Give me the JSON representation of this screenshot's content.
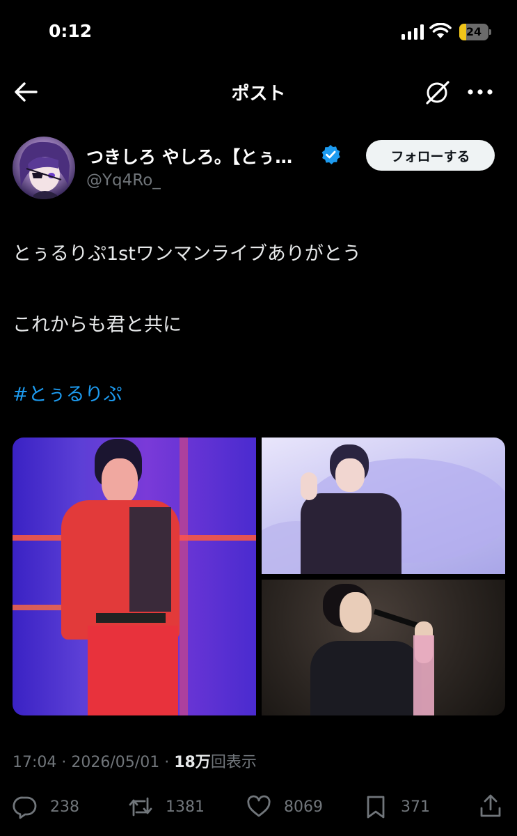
{
  "status_bar": {
    "time": "0:12",
    "battery": "24",
    "battery_level": 0.24
  },
  "nav": {
    "title": "ポスト"
  },
  "author": {
    "name": "つきしろ やしろ。【とぅ…",
    "handle": "@Yq4Ro_",
    "follow_label": "フォローする"
  },
  "post": {
    "line1": "とぅるりぷ1stワンマンライブありがとう",
    "line2": "これからも君と共に",
    "hashtag": "#とぅるりぷ"
  },
  "meta": {
    "time": "17:04",
    "separator1": " · ",
    "date": "2026/05/01",
    "separator2": " · ",
    "views_number": "18万",
    "views_label": "回表示"
  },
  "actions": {
    "replies": "238",
    "reposts": "1381",
    "likes": "8069",
    "bookmarks": "371"
  },
  "icons": [
    "back-arrow-icon",
    "grok-icon",
    "more-icon",
    "verified-icon",
    "reply-icon",
    "repost-icon",
    "like-icon",
    "bookmark-icon",
    "share-icon"
  ],
  "colors": {
    "background": "#000000",
    "text": "#e7e9ea",
    "muted": "#71767b",
    "link": "#1d9bf0",
    "verified": "#1d9bf0",
    "follow_bg": "#eff3f4"
  }
}
